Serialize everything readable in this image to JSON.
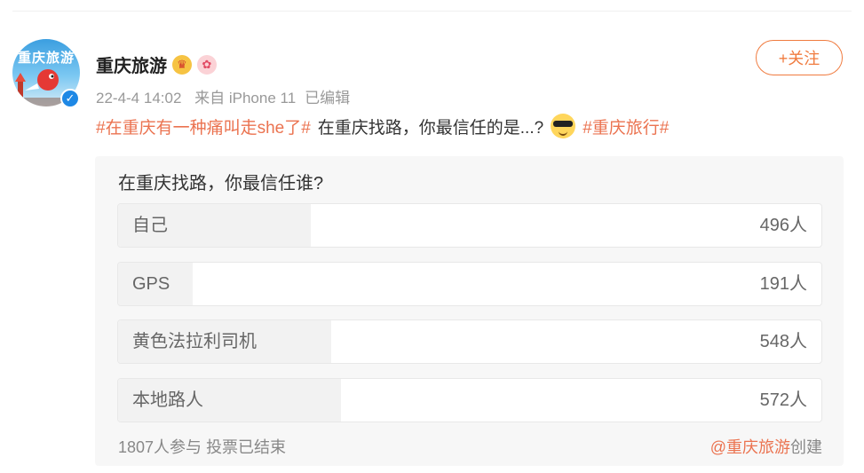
{
  "post": {
    "author": "重庆旅游",
    "avatar_text": "重庆旅游",
    "timestamp": "22-4-4 14:02",
    "source": "来自 iPhone 11",
    "edited": "已编辑",
    "follow_label": "+关注",
    "hashtag1": "#在重庆有一种痛叫走she了#",
    "text": "在重庆找路，你最信任的是...?",
    "hashtag2": "#重庆旅行#"
  },
  "poll": {
    "question": "在重庆找路，你最信任谁?",
    "options": [
      {
        "label": "自己",
        "count": "496人",
        "votes": 496
      },
      {
        "label": "GPS",
        "count": "191人",
        "votes": 191
      },
      {
        "label": "黄色法拉利司机",
        "count": "548人",
        "votes": 548
      },
      {
        "label": "本地路人",
        "count": "572人",
        "votes": 572
      }
    ],
    "participants": "1807人参与",
    "status": "投票已结束",
    "creator": "@重庆旅游",
    "created_suffix": "创建"
  },
  "colors": {
    "accent": "#eb7350",
    "verified": "#1e88e5"
  }
}
